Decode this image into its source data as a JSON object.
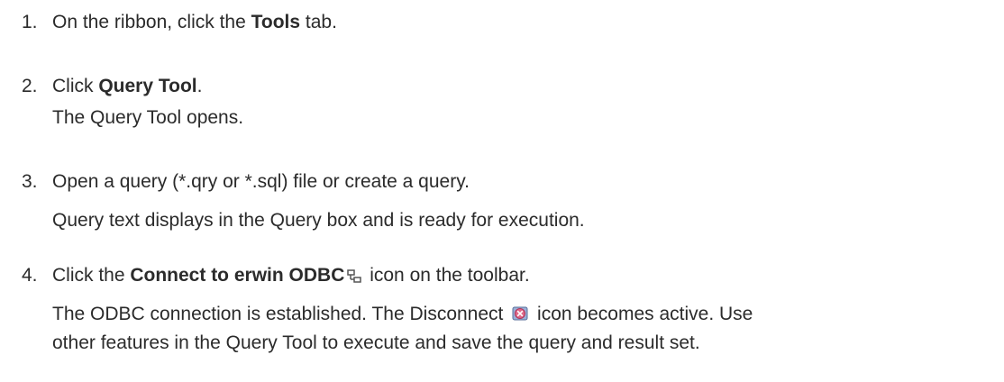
{
  "steps": [
    {
      "number": "1.",
      "pre": "On the ribbon, click the ",
      "bold": "Tools",
      "post": " tab."
    },
    {
      "number": "2.",
      "pre": "Click ",
      "bold": "Query Tool",
      "post": ".",
      "result": "The Query Tool opens."
    },
    {
      "number": "3.",
      "text": "Open a query (*.qry or *.sql) file or create a query.",
      "result": "Query text displays in the Query box and is ready for execution."
    },
    {
      "number": "4.",
      "pre": "Click the ",
      "bold": "Connect to erwin ODBC",
      "post": " icon on the toolbar.",
      "icon": "connect-odbc-icon",
      "result_line1_pre": "The ODBC connection is established. The Disconnect ",
      "result_line1_icon": "disconnect-icon",
      "result_line1_post": " icon becomes active. Use",
      "result_line2": "other features in the Query Tool to execute and save the query and result set."
    }
  ]
}
